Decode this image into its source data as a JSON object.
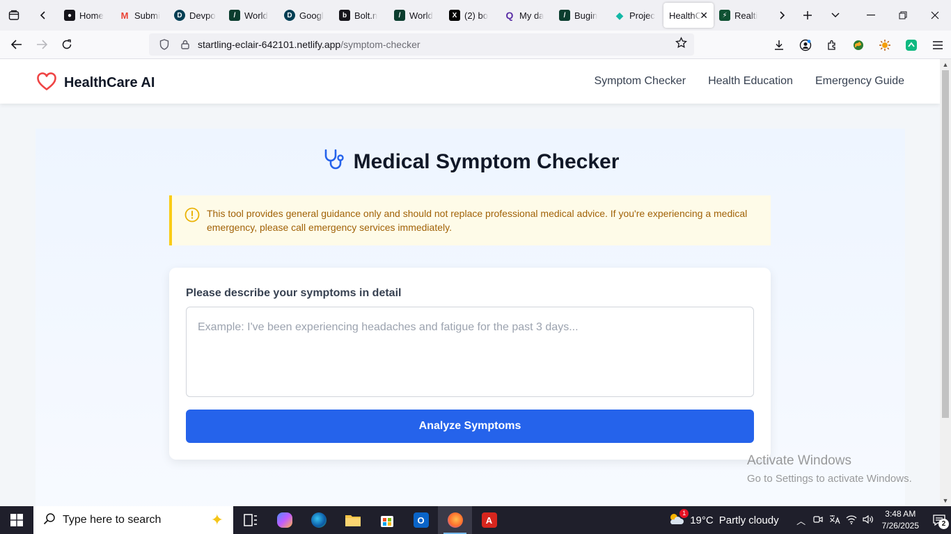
{
  "browser": {
    "tabs": [
      {
        "label": "Home",
        "favicon": "github-icon",
        "color": "#15141a"
      },
      {
        "label": "Submi",
        "favicon": "gmail-icon",
        "color": "#ea4335"
      },
      {
        "label": "Devpo",
        "favicon": "devpost-icon",
        "color": "#003e54"
      },
      {
        "label": "World",
        "favicon": "world-icon",
        "color": "#0b3d2e"
      },
      {
        "label": "Googl",
        "favicon": "devpost-icon",
        "color": "#003e54"
      },
      {
        "label": "Bolt.n",
        "favicon": "bolt-icon",
        "color": "#15141a"
      },
      {
        "label": "World",
        "favicon": "world-icon",
        "color": "#0b3d2e"
      },
      {
        "label": "(2) bo",
        "favicon": "x-icon",
        "color": "#000000"
      },
      {
        "label": "My da",
        "favicon": "q-icon",
        "color": "#5a2ea6"
      },
      {
        "label": "Bugin",
        "favicon": "world-icon",
        "color": "#0b3d2e"
      },
      {
        "label": "Projec",
        "favicon": "diamond-icon",
        "color": "#14b8a6"
      },
      {
        "label": "HealthC",
        "favicon": "",
        "color": "#ffffff",
        "active": true
      },
      {
        "label": "Realti",
        "favicon": "pulse-icon",
        "color": "#0f5132"
      }
    ],
    "url_host": "startling-eclair-642101.netlify.app",
    "url_path": "/symptom-checker"
  },
  "site": {
    "brand": "HealthCare AI",
    "nav": [
      "Symptom Checker",
      "Health Education",
      "Emergency Guide"
    ],
    "title": "Medical Symptom Checker",
    "alert": "This tool provides general guidance only and should not replace professional medical advice. If you're experiencing a medical emergency, please call emergency services immediately.",
    "form_label": "Please describe your symptoms in detail",
    "placeholder": "Example: I've been experiencing headaches and fatigue for the past 3 days...",
    "button": "Analyze Symptoms"
  },
  "watermark": {
    "line1": "Activate Windows",
    "line2": "Go to Settings to activate Windows."
  },
  "taskbar": {
    "search_placeholder": "Type here to search",
    "weather_temp": "19°C",
    "weather_text": "Partly cloudy",
    "weather_badge": "1",
    "time": "3:48 AM",
    "date": "7/26/2025",
    "notifications": "2"
  },
  "colors": {
    "accent_blue": "#2563eb",
    "heart_red": "#ef4444",
    "alert_border": "#facc15",
    "alert_text": "#a16207"
  }
}
